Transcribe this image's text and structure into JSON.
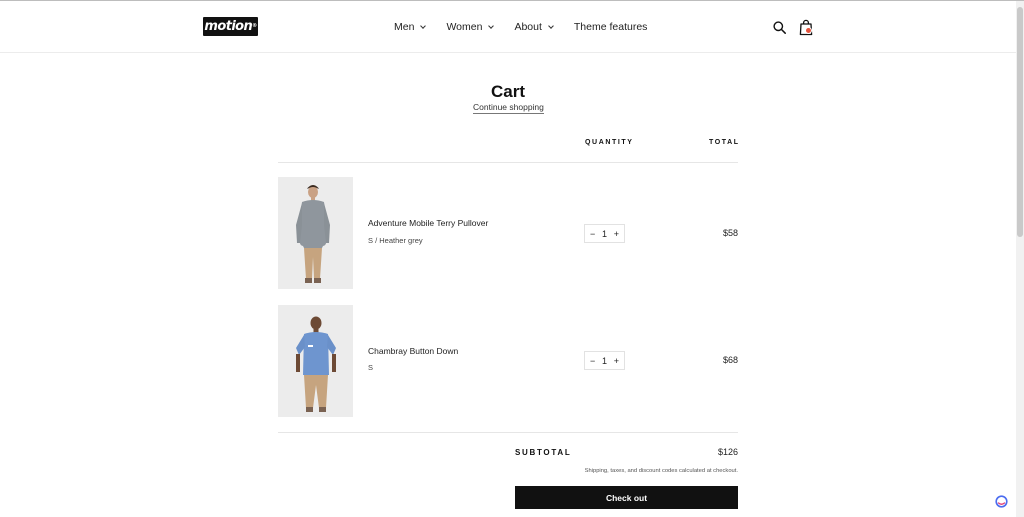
{
  "header": {
    "logo_text": "motion",
    "logo_mark": "®",
    "nav": [
      {
        "label": "Men",
        "has_dropdown": true
      },
      {
        "label": "Women",
        "has_dropdown": true
      },
      {
        "label": "About",
        "has_dropdown": true
      },
      {
        "label": "Theme features",
        "has_dropdown": false
      }
    ],
    "icons": {
      "search": "search-icon",
      "cart": "shopping-bag-icon"
    },
    "cart_badge_color": "#e5533d"
  },
  "cart": {
    "title": "Cart",
    "continue_link": "Continue shopping",
    "columns": {
      "quantity": "QUANTITY",
      "total": "TOTAL"
    },
    "items": [
      {
        "name": "Adventure Mobile Terry Pullover",
        "variant": "S / Heather grey",
        "quantity": "1",
        "total": "$58",
        "image": "man-grey-pullover-photo"
      },
      {
        "name": "Chambray Button Down",
        "variant": "S",
        "quantity": "1",
        "total": "$68",
        "image": "man-blue-chambray-shirt-photo"
      }
    ],
    "subtotal_label": "SUBTOTAL",
    "subtotal_value": "$126",
    "shipping_note": "Shipping, taxes, and discount codes calculated at checkout.",
    "checkout_label": "Check out"
  },
  "qty_controls": {
    "minus": "−",
    "plus": "+"
  },
  "colors": {
    "accent": "#111111",
    "badge": "#e5533d",
    "divider": "#e6e6e6"
  }
}
